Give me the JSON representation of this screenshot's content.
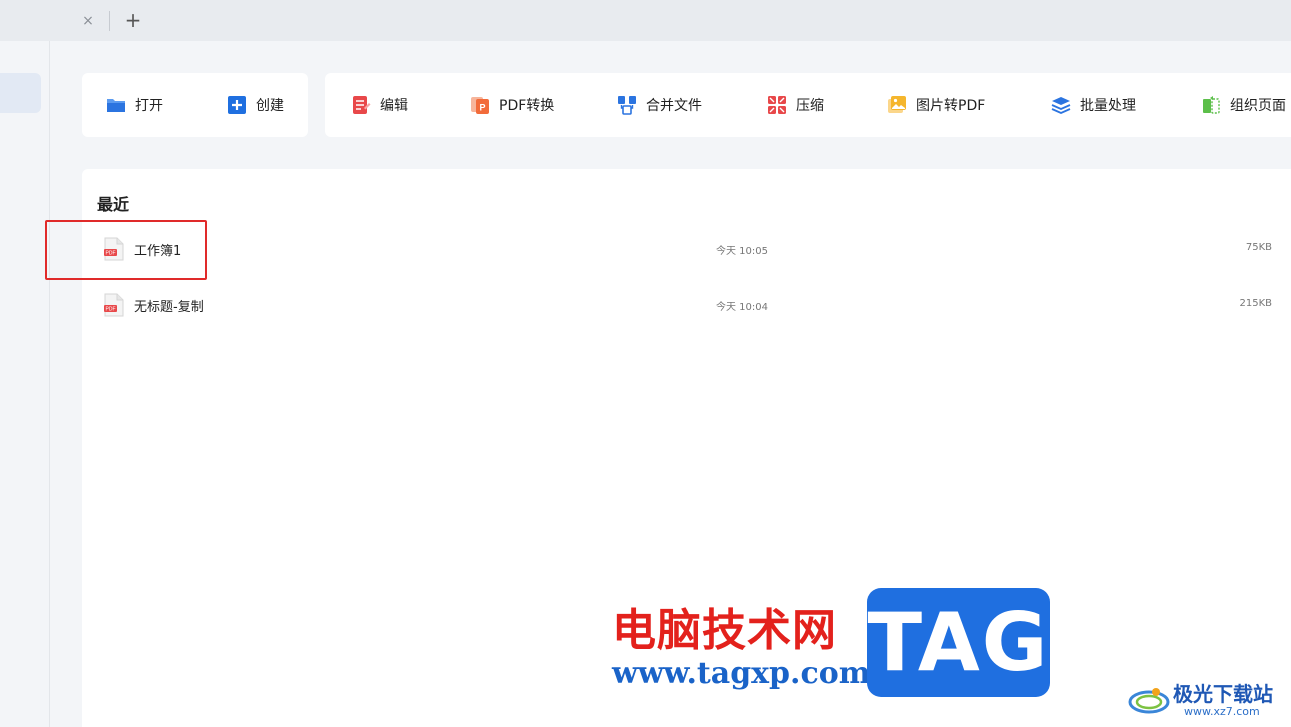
{
  "tabbar": {
    "close_glyph": "×",
    "add_glyph": "+"
  },
  "toolbar": {
    "group_a": [
      {
        "label": "打开",
        "icon": "folder-open-icon",
        "color": "#2b74e0"
      },
      {
        "label": "创建",
        "icon": "plus-square-icon",
        "color": "#1f6fe0"
      }
    ],
    "group_b": [
      {
        "label": "编辑",
        "icon": "edit-doc-icon",
        "color": "#e8484a"
      },
      {
        "label": "PDF转换",
        "icon": "pdf-convert-icon",
        "color": "#f26b3a"
      },
      {
        "label": "合并文件",
        "icon": "merge-icon",
        "color": "#2b74e0"
      },
      {
        "label": "压缩",
        "icon": "compress-icon",
        "color": "#e8484a"
      },
      {
        "label": "图片转PDF",
        "icon": "image-to-pdf-icon",
        "color": "#f5b62d"
      },
      {
        "label": "批量处理",
        "icon": "batch-layers-icon",
        "color": "#2b74e0"
      },
      {
        "label": "组织页面",
        "icon": "organize-pages-icon",
        "color": "#5cbf4a"
      }
    ]
  },
  "recent": {
    "title": "最近",
    "files": [
      {
        "name": "工作簿1",
        "time": "今天 10:05",
        "size": "75KB",
        "icon": "pdf-file-icon",
        "highlighted": true
      },
      {
        "name": "无标题-复制",
        "time": "今天 10:04",
        "size": "215KB",
        "icon": "pdf-file-icon",
        "highlighted": false
      }
    ]
  },
  "watermark": {
    "site_cn": "电脑技术网",
    "url": "www.tagxp.com",
    "tag": "TAG",
    "logo_cn": "极光下载站",
    "logo_url": "www.xz7.com"
  },
  "colors": {
    "highlight_border": "#e02a2a",
    "accent": "#1f6fe0"
  }
}
